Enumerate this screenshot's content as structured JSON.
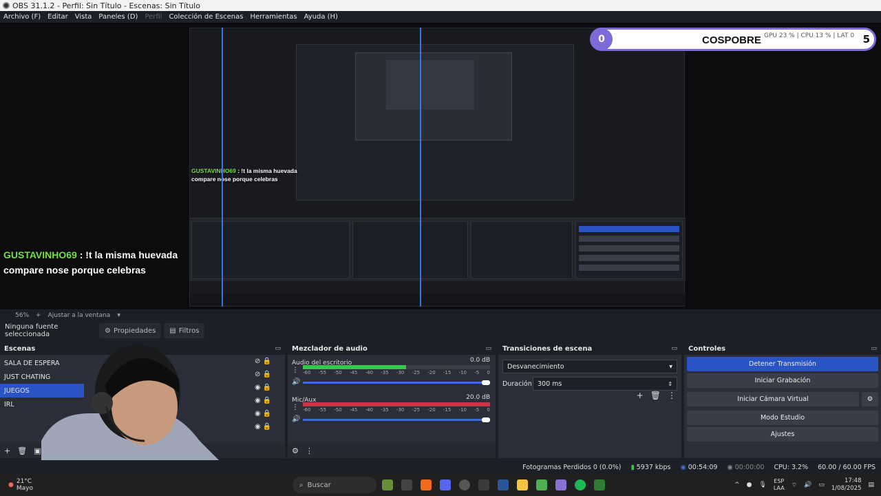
{
  "window": {
    "title": "OBS 31.1.2 - Perfil: Sin Título - Escenas: Sin Título"
  },
  "menu": [
    "Archivo (F)",
    "Editar",
    "Vista",
    "Paneles (D)",
    "Perfil",
    "Colección de Escenas",
    "Herramientas",
    "Ayuda (H)"
  ],
  "overlay": {
    "count": "0",
    "brand": "COSPOBRE",
    "gpu": "GPU 23 %",
    "cpu": "CPU 13 %",
    "lat": "LAT 0",
    "right_num": "5"
  },
  "chat": {
    "user": "GUSTAVINHO69",
    "line1": " : !t la misma huevada",
    "line2": "compare nose porque celebras"
  },
  "zoom": {
    "percent": "56%",
    "fit": "Ajustar a la ventana"
  },
  "source_bar": {
    "no_source": "Ninguna fuente seleccionada",
    "properties": "Propiedades",
    "filters": "Filtros"
  },
  "scenes": {
    "title": "Escenas",
    "items": [
      {
        "name": "SALA DE ESPERA",
        "active": false
      },
      {
        "name": "JUST CHATING",
        "active": false
      },
      {
        "name": "JUEGOS",
        "active": true
      },
      {
        "name": "IRL",
        "active": false
      }
    ]
  },
  "mixer": {
    "title": "Mezclador de audio",
    "scale": [
      "-60",
      "-55",
      "-50",
      "-45",
      "-40",
      "-35",
      "-30",
      "-25",
      "-20",
      "-15",
      "-10",
      "-5",
      "0"
    ],
    "channels": [
      {
        "name": "Audio del escritorio",
        "db": "0.0 dB",
        "level": 0.55,
        "color": "#32c84a"
      },
      {
        "name": "Mic/Aux",
        "db": "20.0 dB",
        "level": 1.0,
        "color": "#c8364a"
      }
    ]
  },
  "transitions": {
    "title": "Transiciones de escena",
    "selected": "Desvanecimiento",
    "duration_label": "Duración",
    "duration_value": "300 ms"
  },
  "controls": {
    "title": "Controles",
    "buttons": [
      "Detener Transmisión",
      "Iniciar Grabación",
      "Iniciar Cámara Virtual",
      "Modo Estudio",
      "Ajustes"
    ]
  },
  "status": {
    "dropped": "Fotogramas Perdidos 0 (0.0%)",
    "kbps": "5937 kbps",
    "stream_time": "00:54:09",
    "rec_time": "00:00:00",
    "cpu": "CPU: 3.2%",
    "fps": "60.00 / 60.00 FPS"
  },
  "taskbar": {
    "weather_temp": "21°C",
    "weather_desc": "Mayo",
    "search": "Buscar",
    "lang": "ESP",
    "lang2": "LAA",
    "time": "17:48",
    "date": "1/08/2025"
  }
}
